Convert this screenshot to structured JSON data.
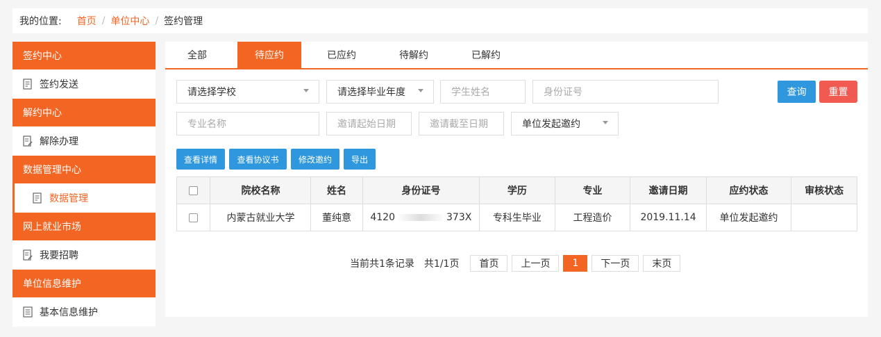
{
  "breadcrumb": {
    "prefix": "我的位置:",
    "home": "首页",
    "center": "单位中心",
    "current": "签约管理",
    "sep": "/"
  },
  "sidebar": {
    "groups": [
      {
        "title": "签约中心",
        "item": "签约发送"
      },
      {
        "title": "解约中心",
        "item": "解除办理"
      },
      {
        "title": "数据管理中心",
        "item": "数据管理"
      },
      {
        "title": "网上就业市场",
        "item": "我要招聘"
      },
      {
        "title": "单位信息维护",
        "item": "基本信息维护"
      }
    ]
  },
  "tabs": [
    "全部",
    "待应约",
    "已应约",
    "待解约",
    "已解约"
  ],
  "filters": {
    "school": "请选择学校",
    "year": "请选择毕业年度",
    "student_name": "学生姓名",
    "id_number": "身份证号",
    "major": "专业名称",
    "start_date": "邀请起始日期",
    "end_date": "邀请截至日期",
    "invite_type": "单位发起邀约"
  },
  "buttons": {
    "query": "查询",
    "reset": "重置",
    "detail": "查看详情",
    "agreement": "查看协议书",
    "modify": "修改邀约",
    "export": "导出"
  },
  "table": {
    "headers": [
      "院校名称",
      "姓名",
      "身份证号",
      "学历",
      "专业",
      "邀请日期",
      "应约状态",
      "审核状态"
    ],
    "rows": [
      {
        "school": "内蒙古就业大学",
        "name": "董纯意",
        "id_start": "4120",
        "id_end": "373X",
        "education": "专科生毕业",
        "major": "工程造价",
        "date": "2019.11.14",
        "status": "单位发起邀约",
        "review": ""
      }
    ]
  },
  "pager": {
    "summary": "当前共1条记录",
    "pages": "共1/1页",
    "first": "首页",
    "prev": "上一页",
    "current": "1",
    "next": "下一页",
    "last": "末页"
  },
  "colors": {
    "accent": "#f26522",
    "blue": "#2f97dd",
    "red": "#f15a50"
  }
}
